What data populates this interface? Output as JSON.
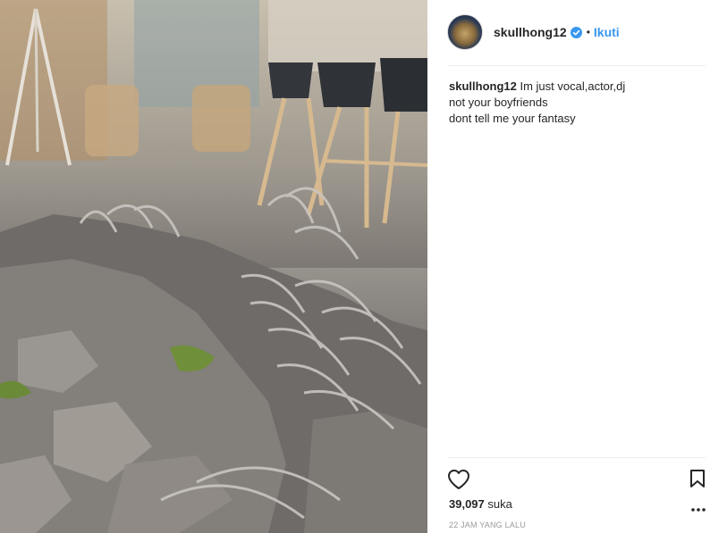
{
  "post": {
    "author": {
      "username": "skullhong12",
      "verified_icon": "verified-badge-icon",
      "avatar": "avatar"
    },
    "follow": {
      "separator": "•",
      "label": "Ikuti"
    },
    "caption": {
      "username": "skullhong12",
      "lines": [
        "Im just vocal,actor,dj",
        "not your boyfriends",
        "dont tell me your fantasy"
      ]
    },
    "likes": {
      "count": "39,097",
      "label": "suka"
    },
    "timestamp": "22 JAM YANG LALU",
    "icons": {
      "like": "heart-icon",
      "save": "bookmark-icon",
      "more": "more-options-icon"
    },
    "colors": {
      "accent": "#3897f0",
      "text": "#262626",
      "muted": "#999999",
      "divider": "#efefef"
    }
  }
}
